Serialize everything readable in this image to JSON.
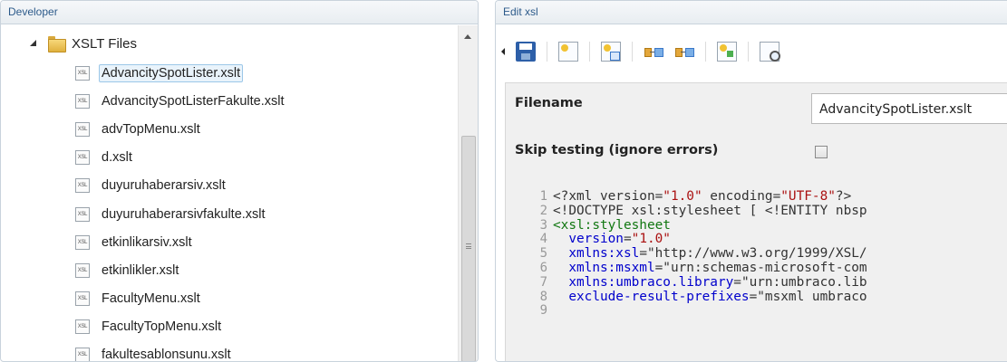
{
  "left_panel": {
    "title": "Developer",
    "root": {
      "label": "XSLT Files",
      "icon": "folder-icon",
      "expanded": true
    },
    "file_icon_text": "XSL",
    "files": [
      {
        "name": "AdvancitySpotLister.xslt",
        "selected": true
      },
      {
        "name": "AdvancitySpotListerFakulte.xslt",
        "selected": false
      },
      {
        "name": "advTopMenu.xslt",
        "selected": false
      },
      {
        "name": "d.xslt",
        "selected": false
      },
      {
        "name": "duyuruhaberarsiv.xslt",
        "selected": false
      },
      {
        "name": "duyuruhaberarsivfakulte.xslt",
        "selected": false
      },
      {
        "name": "etkinlikarsiv.xslt",
        "selected": false
      },
      {
        "name": "etkinlikler.xslt",
        "selected": false
      },
      {
        "name": "FacultyMenu.xslt",
        "selected": false
      },
      {
        "name": "FacultyTopMenu.xslt",
        "selected": false
      },
      {
        "name": "fakultesablonsunu.xslt",
        "selected": false
      }
    ]
  },
  "right_panel": {
    "title": "Edit xsl",
    "toolbar": {
      "icons": [
        "collapse-arrow-icon",
        "save-icon",
        "insert-value-icon",
        "insert-macro-icon",
        "choose-flow-icon",
        "foreach-flow-icon",
        "insert-template-icon",
        "preview-icon"
      ]
    },
    "filename_label": "Filename",
    "filename_value": "AdvancitySpotLister.xslt",
    "skip_testing_label": "Skip testing (ignore errors)",
    "skip_testing_checked": false,
    "code_lines": [
      {
        "num": "1",
        "text": "<?xml version=\"1.0\" encoding=\"UTF-8\"?>"
      },
      {
        "num": "2",
        "text": "<!DOCTYPE xsl:stylesheet [ <!ENTITY nbsp"
      },
      {
        "num": "3",
        "text": "<xsl:stylesheet"
      },
      {
        "num": "4",
        "text": "  version=\"1.0\""
      },
      {
        "num": "5",
        "text": "  xmlns:xsl=\"http://www.w3.org/1999/XSL/"
      },
      {
        "num": "6",
        "text": "  xmlns:msxml=\"urn:schemas-microsoft-com"
      },
      {
        "num": "7",
        "text": "  xmlns:umbraco.library=\"urn:umbraco.lib"
      },
      {
        "num": "8",
        "text": "  exclude-result-prefixes=\"msxml umbraco"
      },
      {
        "num": "9",
        "text": ""
      }
    ]
  },
  "colors": {
    "header_text": "#2c5a8a",
    "selection_bg": "#e9f3fb",
    "selection_border": "#9cc7e8",
    "tag_color": "#117711",
    "attr_color": "#0000cc",
    "string_color": "#aa1111"
  }
}
